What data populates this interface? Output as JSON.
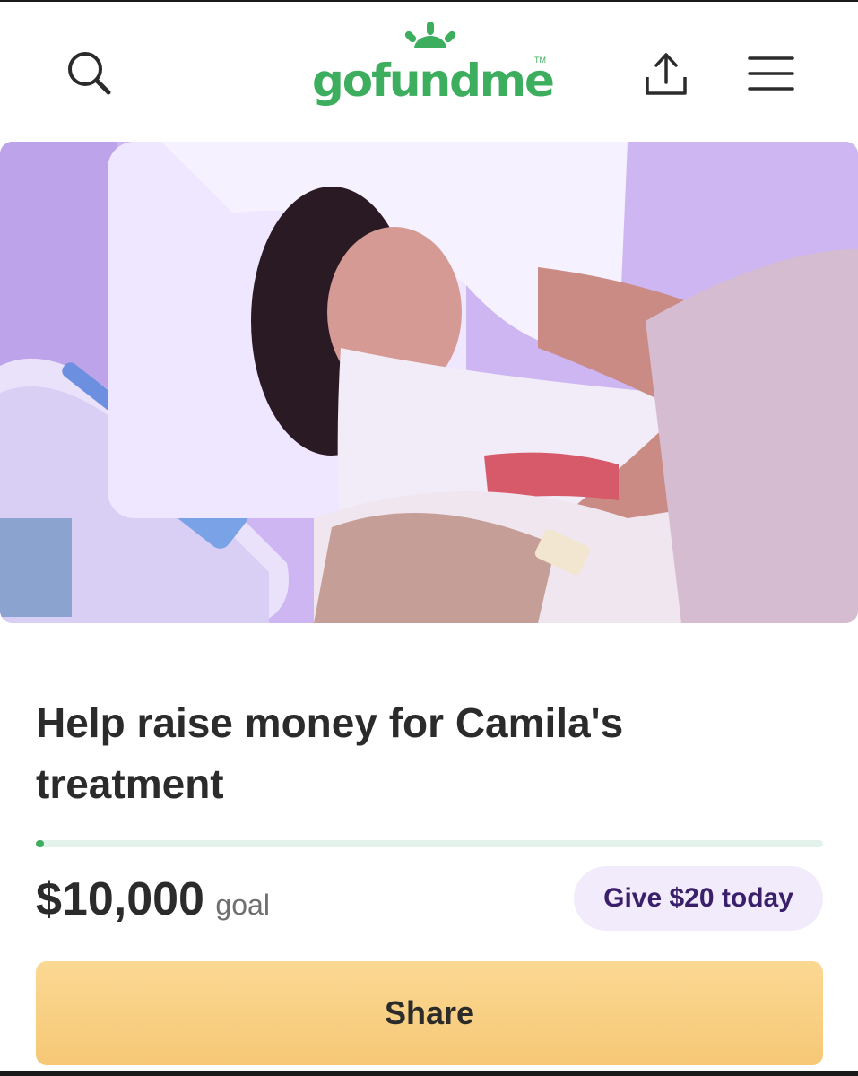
{
  "header": {
    "logo_text": "gofundme",
    "logo_tm": "TM",
    "search_icon": "search-icon",
    "share_icon": "share-upload-icon",
    "menu_icon": "hamburger-menu-icon"
  },
  "hero": {
    "image": "photo of a girl sleeping in a hospital bed"
  },
  "campaign": {
    "title": "Help raise money for Camila's treatment",
    "goal_amount": "$10,000",
    "goal_label": "goal",
    "progress_fraction": 0.005,
    "give_button_label": "Give $20 today",
    "share_button_label": "Share"
  },
  "colors": {
    "brand_green": "#3cae5e",
    "share_button": "#f8cf84",
    "give_button_bg": "#f1ebfb",
    "give_button_text": "#3a1f6b"
  }
}
